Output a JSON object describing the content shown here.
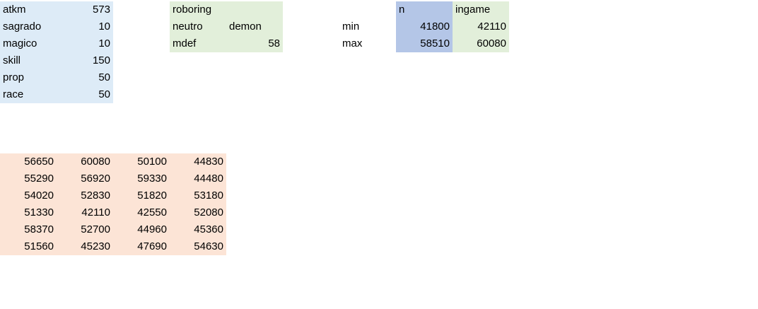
{
  "stats": [
    {
      "label": "atkm",
      "value": "573"
    },
    {
      "label": "sagrado",
      "value": "10"
    },
    {
      "label": "magico",
      "value": "10"
    },
    {
      "label": "skill",
      "value": "150"
    },
    {
      "label": "prop",
      "value": "50"
    },
    {
      "label": "race",
      "value": "50"
    }
  ],
  "monster": {
    "name": "roboring",
    "element": "neutro",
    "race": "demon",
    "mdef_label": "mdef",
    "mdef_value": "58"
  },
  "range": {
    "header_n": "n",
    "header_ingame": "ingame",
    "min_label": "min",
    "min_n": "41800",
    "min_ingame": "42110",
    "max_label": "max",
    "max_n": "58510",
    "max_ingame": "60080"
  },
  "samples": [
    [
      "56650",
      "60080",
      "50100",
      "44830"
    ],
    [
      "55290",
      "56920",
      "59330",
      "44480"
    ],
    [
      "54020",
      "52830",
      "51820",
      "53180"
    ],
    [
      "51330",
      "42110",
      "42550",
      "52080"
    ],
    [
      "58370",
      "52700",
      "44960",
      "45360"
    ],
    [
      "51560",
      "45230",
      "47690",
      "54630"
    ]
  ],
  "colors": {
    "stats_fill": "#ddebf7",
    "monster_fill": "#e2efda",
    "n_fill": "#b4c6e7",
    "ingame_fill": "#e2efda",
    "samples_fill": "#fce4d6"
  }
}
